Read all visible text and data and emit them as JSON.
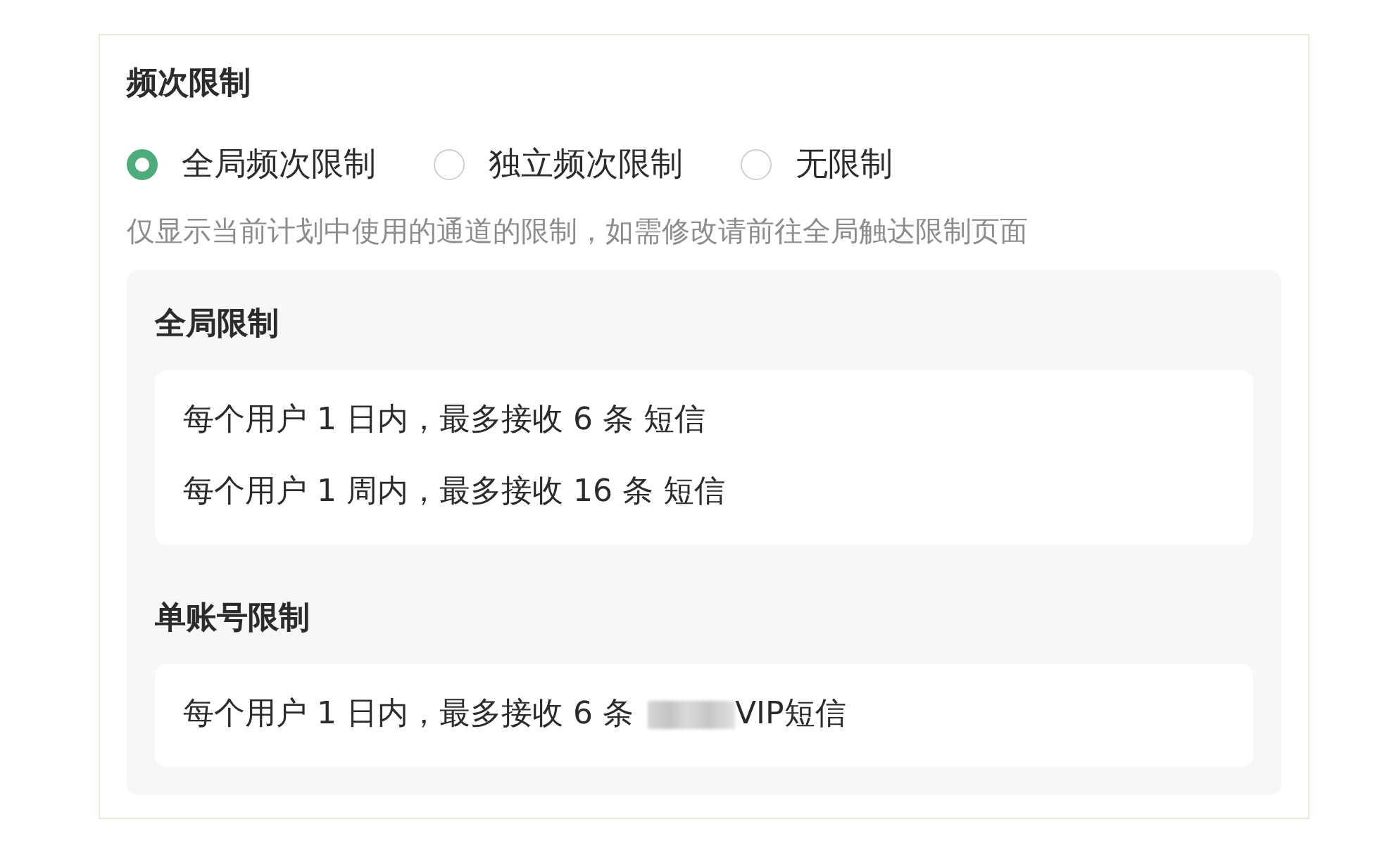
{
  "section": {
    "title": "频次限制",
    "options": [
      {
        "label": "全局频次限制",
        "selected": true
      },
      {
        "label": "独立频次限制",
        "selected": false
      },
      {
        "label": "无限制",
        "selected": false
      }
    ],
    "hint": "仅显示当前计划中使用的通道的限制，如需修改请前往全局触达限制页面"
  },
  "panel": {
    "groups": [
      {
        "title": "全局限制",
        "rules": [
          {
            "text": "每个用户 1 日内，最多接收 6 条 短信",
            "redacted": false
          },
          {
            "text": "每个用户 1 周内，最多接收 16 条 短信",
            "redacted": false
          }
        ]
      },
      {
        "title": "单账号限制",
        "rules": [
          {
            "text": "每个用户 1 日内，最多接收 6 条",
            "redacted": true,
            "suffix": "VIP短信"
          }
        ]
      }
    ]
  }
}
